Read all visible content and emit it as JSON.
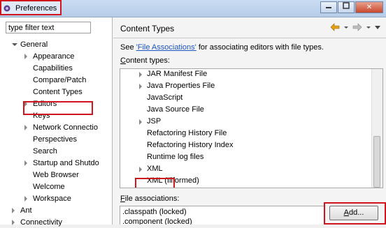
{
  "window": {
    "title": "Preferences"
  },
  "filter": {
    "value": "type filter text"
  },
  "tree": [
    {
      "label": "General",
      "arrow": "open",
      "indent": 0
    },
    {
      "label": "Appearance",
      "arrow": "closed",
      "indent": 1
    },
    {
      "label": "Capabilities",
      "arrow": "",
      "indent": 1
    },
    {
      "label": "Compare/Patch",
      "arrow": "",
      "indent": 1
    },
    {
      "label": "Content Types",
      "arrow": "",
      "indent": 1
    },
    {
      "label": "Editors",
      "arrow": "closed",
      "indent": 1
    },
    {
      "label": "Keys",
      "arrow": "",
      "indent": 1
    },
    {
      "label": "Network Connectio",
      "arrow": "closed",
      "indent": 1
    },
    {
      "label": "Perspectives",
      "arrow": "",
      "indent": 1
    },
    {
      "label": "Search",
      "arrow": "",
      "indent": 1
    },
    {
      "label": "Startup and Shutdo",
      "arrow": "closed",
      "indent": 1
    },
    {
      "label": "Web Browser",
      "arrow": "",
      "indent": 1
    },
    {
      "label": "Welcome",
      "arrow": "",
      "indent": 1
    },
    {
      "label": "Workspace",
      "arrow": "closed",
      "indent": 1
    },
    {
      "label": "Ant",
      "arrow": "closed",
      "indent": 0
    },
    {
      "label": "Connectivity",
      "arrow": "closed",
      "indent": 0
    }
  ],
  "page": {
    "title": "Content Types",
    "see_prefix": "See ",
    "see_link": "'File Associations'",
    "see_suffix": " for associating editors with file types.",
    "content_types_label_mn": "C",
    "content_types_label_rest": "ontent types:",
    "content_types": [
      {
        "label": "JAR Manifest File",
        "arrow": true
      },
      {
        "label": "Java Properties File",
        "arrow": true
      },
      {
        "label": "JavaScript",
        "arrow": false
      },
      {
        "label": "Java Source File",
        "arrow": false
      },
      {
        "label": "JSP",
        "arrow": true
      },
      {
        "label": "Refactoring History File",
        "arrow": false
      },
      {
        "label": "Refactoring History Index",
        "arrow": false
      },
      {
        "label": "Runtime log files",
        "arrow": false
      },
      {
        "label": "XML",
        "arrow": true
      },
      {
        "label": "XML (Illformed)",
        "arrow": false
      }
    ],
    "file_assoc_label_mn": "F",
    "file_assoc_label_rest": "ile associations:",
    "file_associations": [
      ".classpath (locked)",
      ".component (locked)"
    ],
    "add_button_mn": "A",
    "add_button_rest": "dd..."
  }
}
